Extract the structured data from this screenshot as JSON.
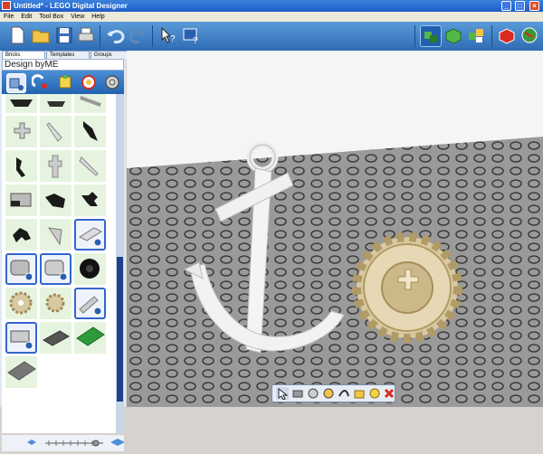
{
  "window": {
    "title": "Untitled* - LEGO Digital Designer"
  },
  "menu": [
    "File",
    "Edit",
    "Tool Box",
    "View",
    "Help"
  ],
  "toolbar": {
    "buttons": [
      "new-file",
      "open-file",
      "save",
      "print",
      "undo",
      "redo",
      "help-pointer",
      "help-book",
      "build-mode",
      "view-mode",
      "building-guide",
      "shop",
      "web"
    ]
  },
  "panel": {
    "tabs": [
      "Bricks",
      "Templates",
      "Groups"
    ],
    "active_tab": "Bricks",
    "palette_name": "Design byME"
  },
  "colors": {
    "brick_tan": "#d9c9a0",
    "selected_border": "#3366cc",
    "baseplate": "#8d8d8d"
  }
}
